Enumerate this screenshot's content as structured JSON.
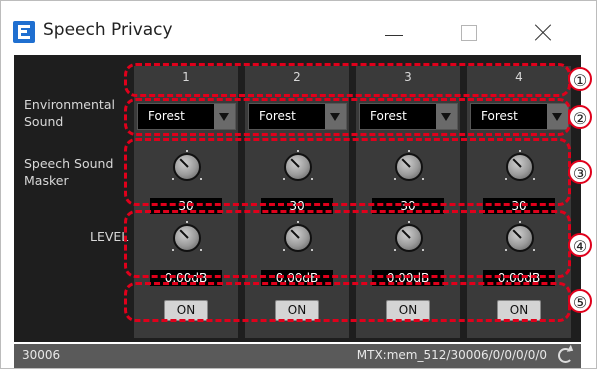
{
  "window": {
    "title": "Speech Privacy"
  },
  "labels": {
    "environmental": "Environmental Sound",
    "speech_masker": "Speech Sound Masker",
    "level": "LEVEL"
  },
  "channels": [
    {
      "number": "1",
      "sound": "Forest",
      "masker": "30",
      "level": "0.00dB",
      "on": "ON"
    },
    {
      "number": "2",
      "sound": "Forest",
      "masker": "30",
      "level": "0.00dB",
      "on": "ON"
    },
    {
      "number": "3",
      "sound": "Forest",
      "masker": "30",
      "level": "0.00dB",
      "on": "ON"
    },
    {
      "number": "4",
      "sound": "Forest",
      "masker": "30",
      "level": "0.00dB",
      "on": "ON"
    }
  ],
  "callouts": [
    "①",
    "②",
    "③",
    "④",
    "⑤"
  ],
  "statusbar": {
    "left": "30006",
    "right": "MTX:mem_512/30006/0/0/0/0/0"
  },
  "colors": {
    "accent": "#e0001b",
    "panel": "#1e1e1e",
    "column": "#3a3a3a"
  }
}
